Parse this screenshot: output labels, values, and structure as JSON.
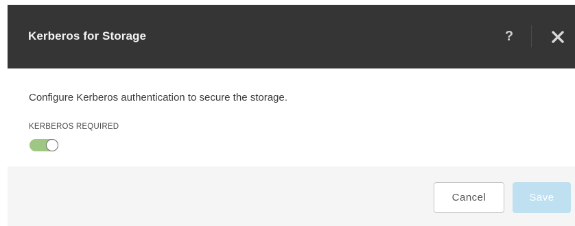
{
  "dialog": {
    "title": "Kerberos for Storage",
    "help_icon": "?",
    "close_icon_name": "close-icon"
  },
  "body": {
    "description": "Configure Kerberos authentication to secure the storage.",
    "kerberos_required_label": "KERBEROS REQUIRED",
    "kerberos_required_on": true
  },
  "footer": {
    "cancel_label": "Cancel",
    "save_label": "Save",
    "save_disabled": true
  },
  "colors": {
    "header_bg": "#353535",
    "toggle_on": "#9dc783",
    "save_disabled_bg": "#bfe0f0",
    "footer_bg": "#f5f5f5"
  }
}
